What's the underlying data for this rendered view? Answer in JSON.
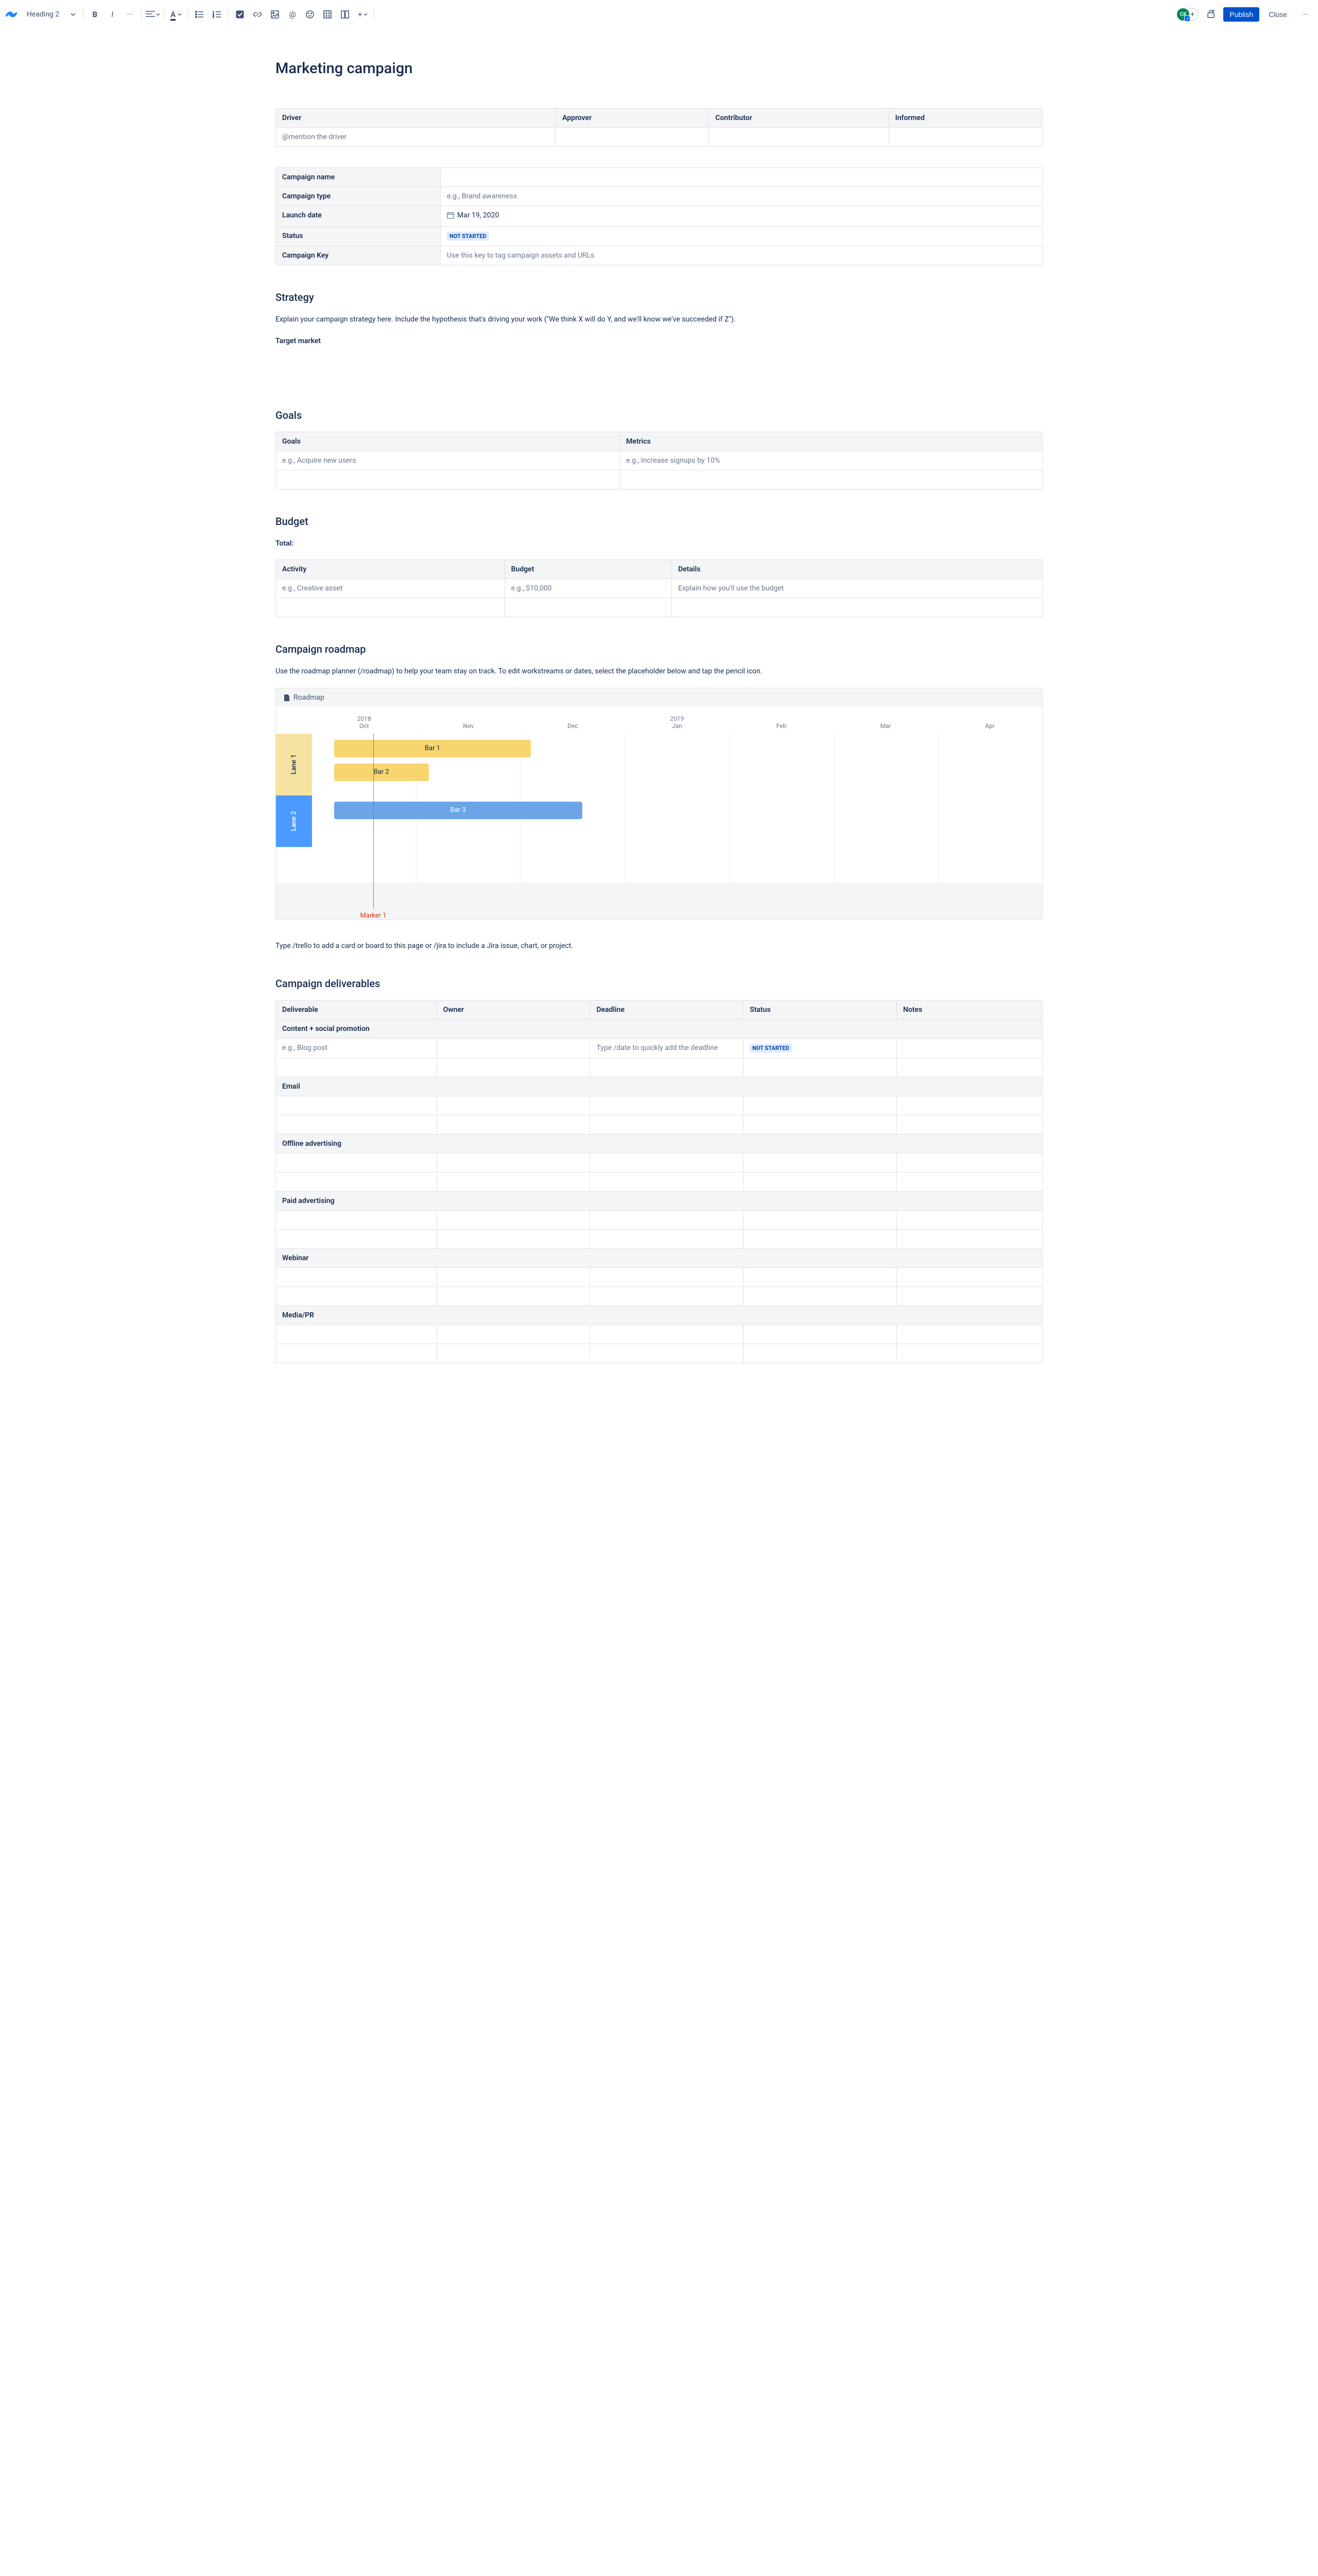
{
  "toolbar": {
    "style": "Heading 2",
    "publish": "Publish",
    "close": "Close",
    "avatar": "CK"
  },
  "page": {
    "title": "Marketing campaign"
  },
  "daci": {
    "headers": [
      "Driver",
      "Approver",
      "Contributor",
      "Informed"
    ],
    "driver_placeholder": "@mention the driver"
  },
  "details": {
    "rows": [
      {
        "label": "Campaign name",
        "value": ""
      },
      {
        "label": "Campaign type",
        "value": "e.g., Brand awareness",
        "placeholder": true
      },
      {
        "label": "Launch date",
        "value": "Mar 19, 2020"
      },
      {
        "label": "Status",
        "lozenge": "NOT STARTED"
      },
      {
        "label": "Campaign Key",
        "value": "Use this key to tag campaign assets and URLs",
        "placeholder": true
      }
    ]
  },
  "strategy": {
    "heading": "Strategy",
    "body": "Explain your campaign strategy here. Include the hypothesis that's driving your work (\"We think X will do Y, and we'll know we've succeeded if Z\").",
    "target_market": "Target market"
  },
  "goals": {
    "heading": "Goals",
    "headers": [
      "Goals",
      "Metrics"
    ],
    "example": [
      "e.g., Acquire new users",
      "e.g., Increase signups by 10%"
    ]
  },
  "budget": {
    "heading": "Budget",
    "total_label": "Total:",
    "headers": [
      "Activity",
      "Budget",
      "Details"
    ],
    "example": [
      "e.g., Creative asset",
      "e.g., $10,000",
      "Explain how you'll use the budget"
    ]
  },
  "roadmap": {
    "heading": "Campaign roadmap",
    "intro": "Use the roadmap planner (/roadmap) to help your team stay on track. To edit workstreams or dates, select the placeholder below and tap the pencil icon.",
    "panel_title": "Roadmap",
    "months": [
      {
        "year": "2018",
        "m": "Oct"
      },
      {
        "year": "",
        "m": "Nov"
      },
      {
        "year": "",
        "m": "Dec"
      },
      {
        "year": "2019",
        "m": "Jan"
      },
      {
        "year": "",
        "m": "Feb"
      },
      {
        "year": "",
        "m": "Mar"
      },
      {
        "year": "",
        "m": "Apr"
      }
    ],
    "lanes": {
      "l1": "Lane 1",
      "l2": "Lane 2"
    },
    "bars": {
      "b1": "Bar 1",
      "b2": "Bar 2",
      "b3": "Bar 3"
    },
    "marker": "Marker 1",
    "outro": "Type /trello to add a card or board to this page or /jira to include a Jira issue, chart, or project."
  },
  "deliverables": {
    "heading": "Campaign deliverables",
    "headers": [
      "Deliverable",
      "Owner",
      "Deadline",
      "Status",
      "Notes"
    ],
    "sections": [
      "Content + social promotion",
      "Email",
      "Offline advertising",
      "Paid advertising",
      "Webinar",
      "Media/PR"
    ],
    "example_deliverable": "e.g., Blog post",
    "example_deadline": "Type /date to quickly add the deadline",
    "example_status": "NOT STARTED"
  }
}
